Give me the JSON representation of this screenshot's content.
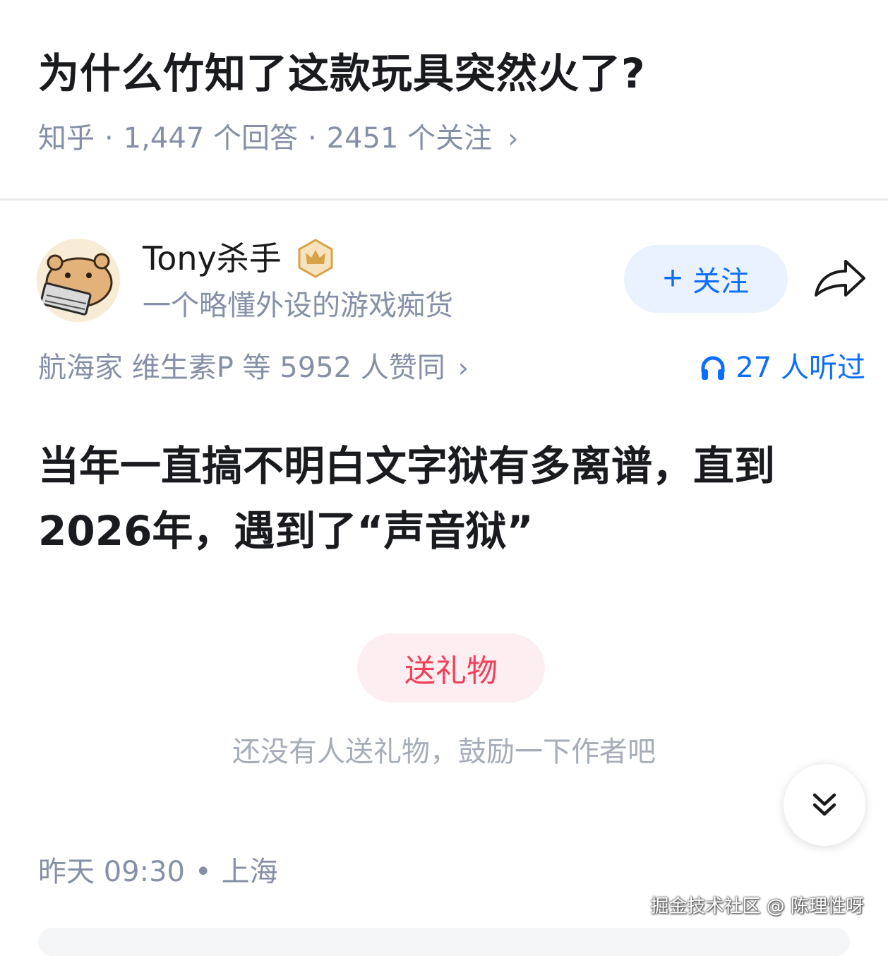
{
  "question": {
    "title": "为什么竹知了这款玩具突然火了?",
    "source": "知乎",
    "answers": "1,447 个回答",
    "followers": "2451 个关注"
  },
  "author": {
    "name": "Tony杀手",
    "bio": "一个略懂外设的游戏痴货",
    "follow_label": "关注"
  },
  "votes": {
    "text": "航海家 维生素P 等 5952 人赞同"
  },
  "listened": {
    "text": "27 人听过"
  },
  "answer": {
    "content": "当年一直搞不明白文字狱有多离谱，直到2026年，遇到了“声音狱”"
  },
  "gift": {
    "button_label": "送礼物",
    "hint": "还没有人送礼物，鼓励一下作者吧"
  },
  "post": {
    "time": "昨天 09:30",
    "location": "上海"
  },
  "watermark": "掘金技术社区 @ 陈理性呀",
  "colors": {
    "accent_blue": "#0d6efd",
    "gift_red": "#f1405a",
    "muted_gray": "#8590a6",
    "badge_gold": "#d8a24a"
  },
  "icons": [
    "chevron-right-icon",
    "crown-badge-icon",
    "share-icon",
    "headphones-icon",
    "double-chevron-down-icon",
    "plus-icon"
  ]
}
